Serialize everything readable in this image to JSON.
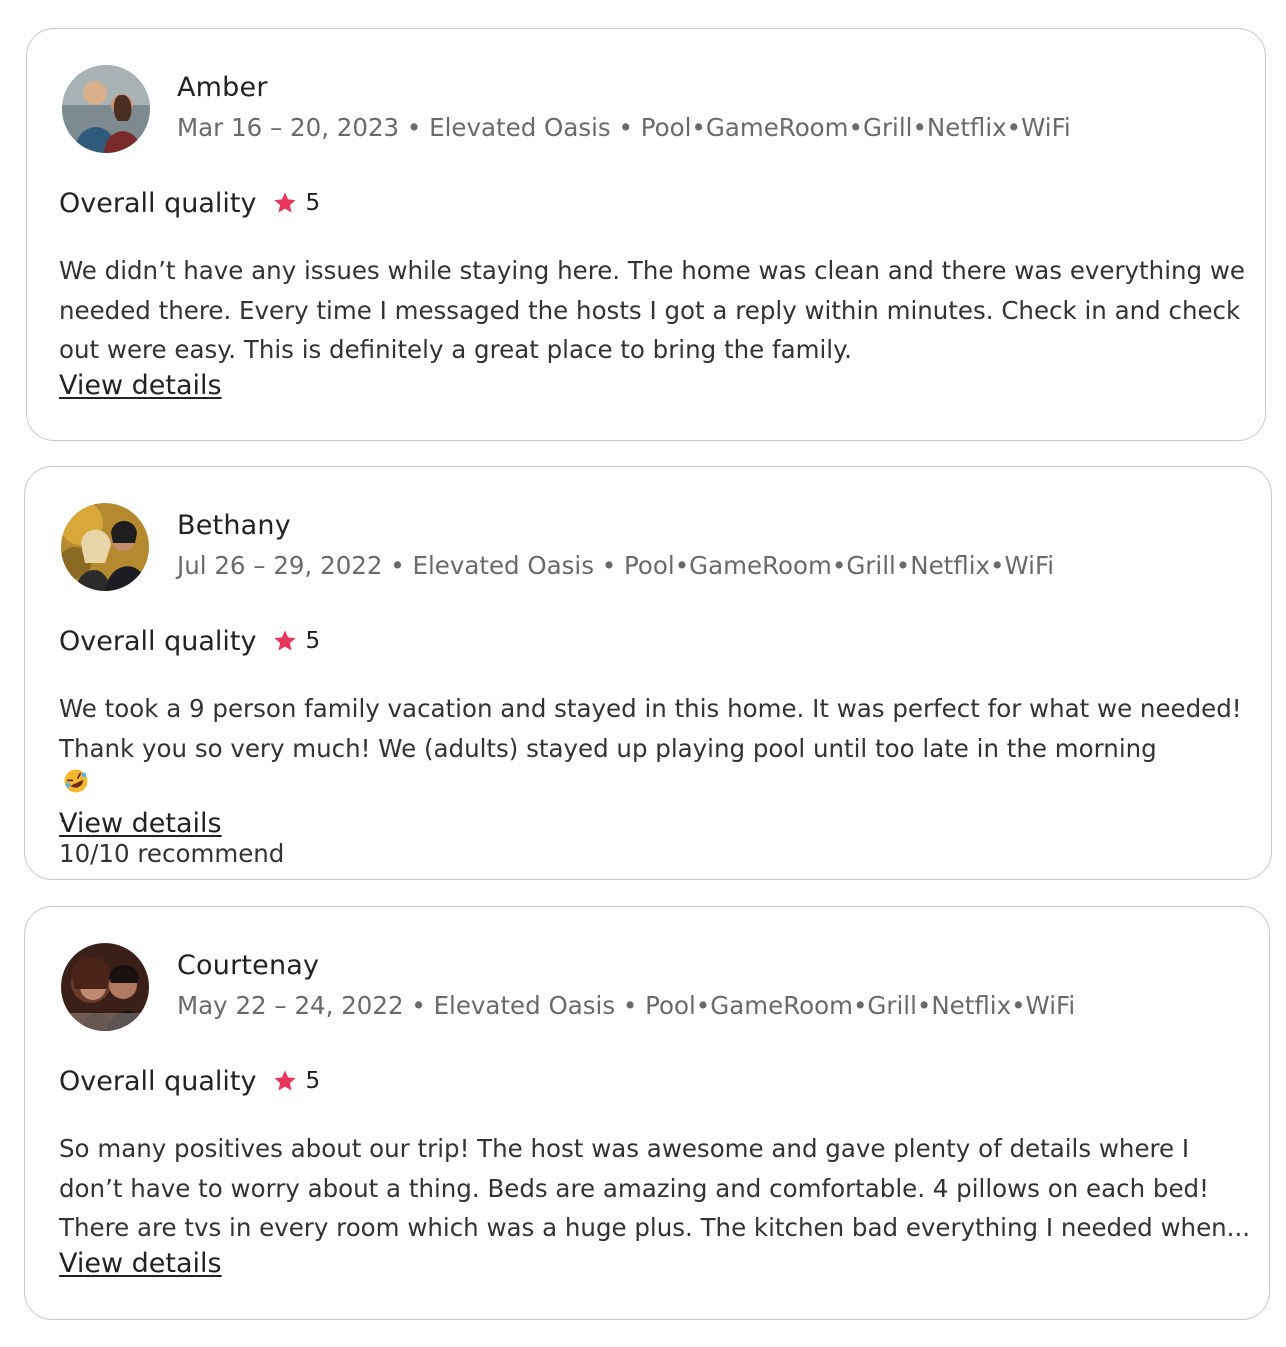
{
  "reviews": [
    {
      "name": "Amber",
      "meta": "Mar 16 – 20, 2023 • Elevated Oasis • Pool•GameRoom•Grill•Netflix•WiFi",
      "rating_label": "Overall quality",
      "rating_value": "5",
      "body_lines": [
        "We didn’t have any issues while staying here. The home was clean and there was everything we",
        "needed there. Every time I messaged the hosts I got a reply within minutes. Check in and check",
        "out were easy. This is definitely a great place to bring the family."
      ],
      "link_label": "View details"
    },
    {
      "name": "Bethany",
      "meta": "Jul 26 – 29, 2022 • Elevated Oasis • Pool•GameRoom•Grill•Netflix•WiFi",
      "rating_label": "Overall quality",
      "rating_value": "5",
      "body_lines": [
        "We took a 9 person family vacation and stayed in this home. It was perfect for what we needed!",
        "Thank you so very much! We (adults) stayed up playing pool until too late in the morning",
        "10/10 recommend"
      ],
      "line2_suffix": ".",
      "emoji": "rolling-on-floor-laughing-emoji",
      "link_label": "View details"
    },
    {
      "name": "Courtenay",
      "meta": "May 22 – 24, 2022 • Elevated Oasis • Pool•GameRoom•Grill•Netflix•WiFi",
      "rating_label": "Overall quality",
      "rating_value": "5",
      "body_lines": [
        "So many positives about our trip! The host was awesome and gave plenty of details where I",
        "don’t have to worry about a thing. Beds are amazing and comfortable. 4 pillows on each bed!",
        "There are tvs in every room which was a huge plus. The kitchen bad everything I needed when..."
      ],
      "link_label": "View details"
    }
  ],
  "colors": {
    "star": "#e8355a",
    "border": "#c9c9c9",
    "muted_text": "#6a6a6a"
  }
}
